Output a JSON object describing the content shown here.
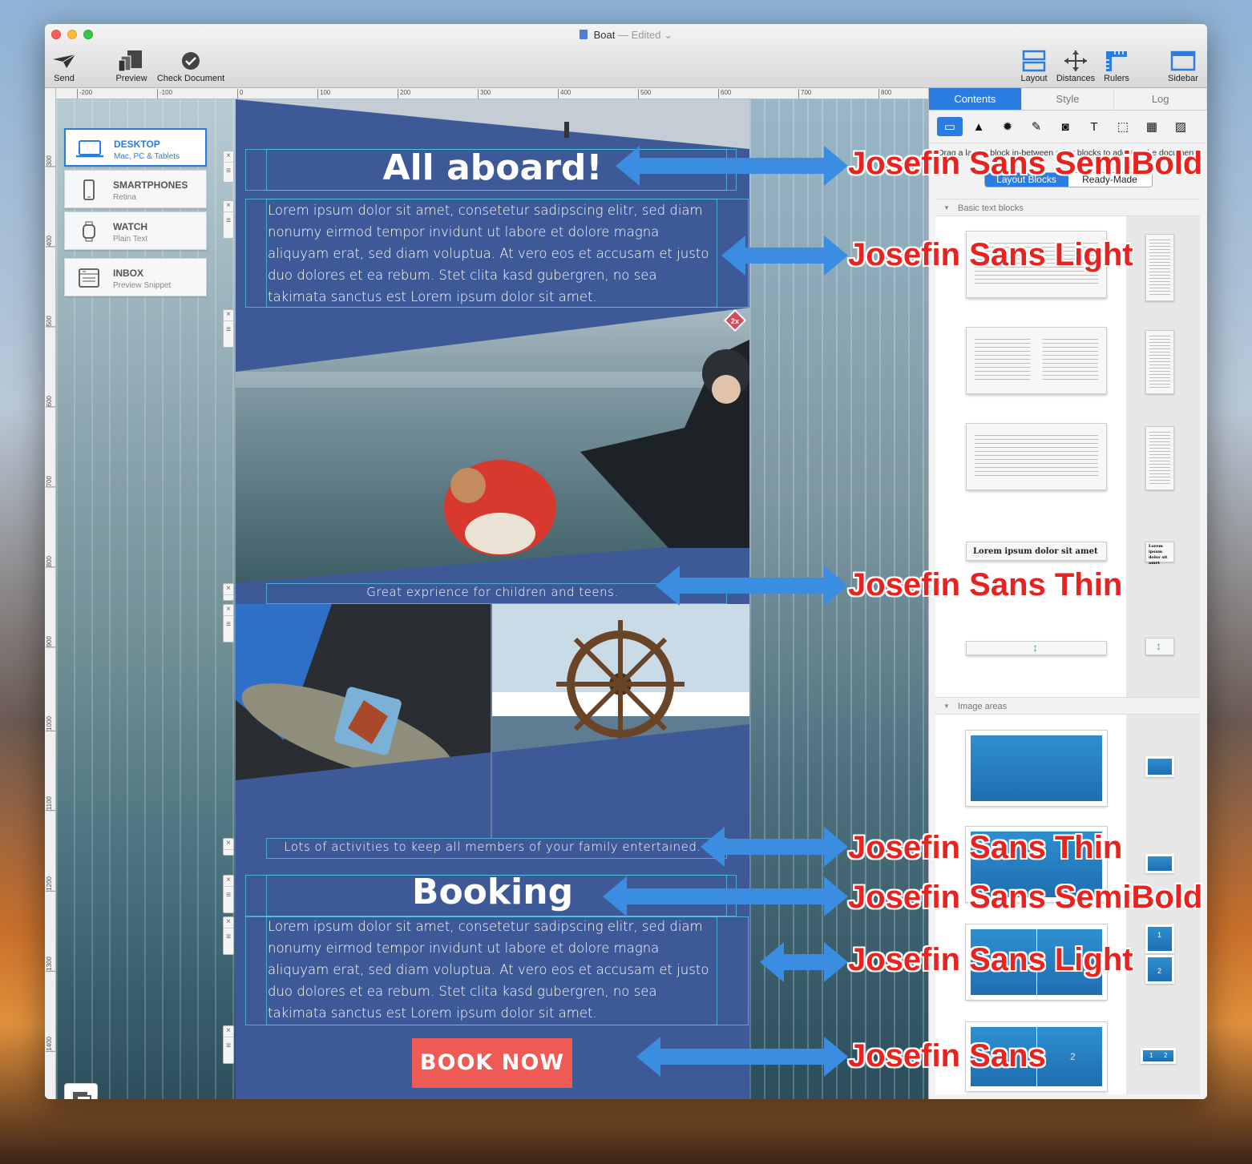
{
  "window": {
    "title": "Boat",
    "status": "— Edited",
    "toolbar_left": [
      {
        "label": "Send",
        "icon": "paper-plane-icon"
      },
      {
        "label": "Preview",
        "icon": "devices-icon"
      },
      {
        "label": "Check Document",
        "icon": "checkmark-icon"
      }
    ],
    "toolbar_right": [
      {
        "label": "Layout",
        "icon": "layout-icon"
      },
      {
        "label": "Distances",
        "icon": "distances-icon"
      },
      {
        "label": "Rulers",
        "icon": "ruler-icon"
      },
      {
        "label": "Sidebar",
        "icon": "sidebar-icon"
      }
    ]
  },
  "ruler": {
    "top_ticks": [
      "-200",
      "-100",
      "0",
      "100",
      "200",
      "300",
      "400",
      "500",
      "600",
      "700",
      "800"
    ],
    "left_ticks": [
      "300",
      "400",
      "500",
      "600",
      "700",
      "800",
      "900",
      "1000",
      "1100",
      "1200",
      "1300",
      "1400"
    ]
  },
  "devices": [
    {
      "name": "DESKTOP",
      "sub": "Mac, PC & Tablets",
      "icon": "laptop-icon",
      "active": true
    },
    {
      "name": "SMARTPHONES",
      "sub": "Retina",
      "icon": "phone-icon",
      "active": false
    },
    {
      "name": "WATCH",
      "sub": "Plain Text",
      "icon": "watch-icon",
      "active": false
    },
    {
      "name": "INBOX",
      "sub": "Preview Snippet",
      "icon": "inbox-icon",
      "active": false
    }
  ],
  "email": {
    "heading1": "All aboard!",
    "paragraph1": "Lorem ipsum dolor sit amet, consetetur sadipscing elitr, sed diam nonumy eirmod tempor invidunt ut labore et dolore magna aliquyam erat, sed diam voluptua. At vero eos et accusam et justo duo dolores et ea rebum. Stet clita kasd gubergren, no sea takimata sanctus est Lorem ipsum dolor sit amet.",
    "badge": "2x",
    "caption1": "Great exprience for children and teens.",
    "caption2": "Lots of activities to keep all members of your family entertained.",
    "heading2": "Booking",
    "paragraph2": "Lorem ipsum dolor sit amet, consetetur sadipscing elitr, sed diam nonumy eirmod tempor invidunt ut labore et dolore magna aliquyam erat, sed diam voluptua. At vero eos et accusam et justo duo dolores et ea rebum. Stet clita kasd gubergren, no sea takimata sanctus est Lorem ipsum dolor sit amet.",
    "button": "BOOK NOW",
    "colors": {
      "background": "#3e5998",
      "button": "#f05a54"
    }
  },
  "sidebar": {
    "tabs": [
      "Contents",
      "Style",
      "Log"
    ],
    "active_tab": "Contents",
    "hint": "Drag a layout block in-between other blocks to add it to the document.",
    "segments": [
      "Layout Blocks",
      "Ready-Made"
    ],
    "section1": "Basic text blocks",
    "section2": "Image areas",
    "thumb_label": "Lorem ipsum dolor sit amet",
    "mini_label": "Lorem ipsum dolor sit amet",
    "img_numbers": [
      "1",
      "2"
    ]
  },
  "annotations": [
    "Josefin Sans SemiBold",
    "Josefin Sans Light",
    "Josefin Sans Thin",
    "Josefin Sans Thin",
    "Josefin Sans SemiBold",
    "Josefin Sans Light",
    "Josefin Sans"
  ],
  "accent_color": "#2b7ce0",
  "annotation_color": "#e8231f",
  "arrow_color": "#3a8de0"
}
